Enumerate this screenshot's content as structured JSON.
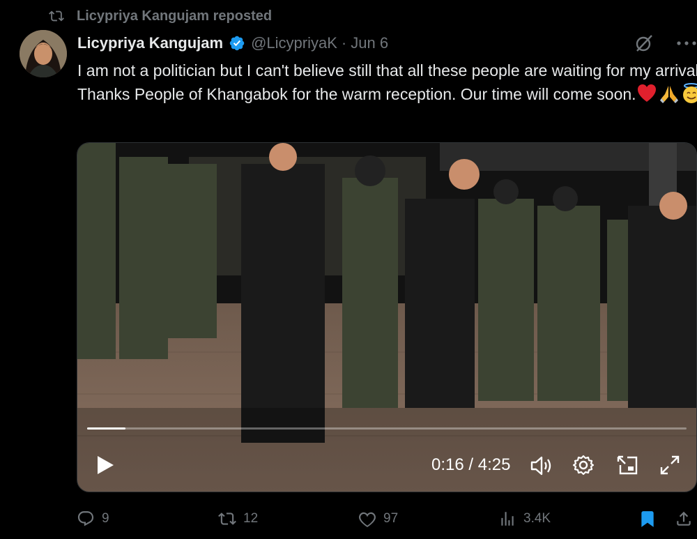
{
  "repost": {
    "label": "Licypriya Kangujam reposted"
  },
  "tweet": {
    "display_name": "Licypriya Kangujam",
    "handle": "@LicypriyaK",
    "separator": "·",
    "date": "Jun 6",
    "text_main": "I am not a politician but I can't believe still that all these people are waiting for my arrival. Thanks People of Khangabok for the warm reception. Our time will come soon."
  },
  "video": {
    "time": "0:16 / 4:25",
    "progress_fraction": 0.064
  },
  "actions": {
    "replies": "9",
    "retweets": "12",
    "likes": "97",
    "views": "3.4K"
  },
  "icons": {
    "repost": "repost-icon",
    "verified": "verified-badge-icon",
    "grok": "grok-icon",
    "more": "more-icon",
    "play": "play-icon",
    "volume": "volume-icon",
    "settings": "settings-icon",
    "pip": "picture-in-picture-icon",
    "fullscreen": "fullscreen-icon",
    "reply": "reply-icon",
    "retweet": "retweet-icon",
    "like": "heart-icon",
    "views": "views-icon",
    "bookmark": "bookmark-icon",
    "share": "share-icon"
  },
  "colors": {
    "accent": "#1d9bf0",
    "muted": "#71767b",
    "text": "#e7e9ea",
    "background": "#000000"
  }
}
